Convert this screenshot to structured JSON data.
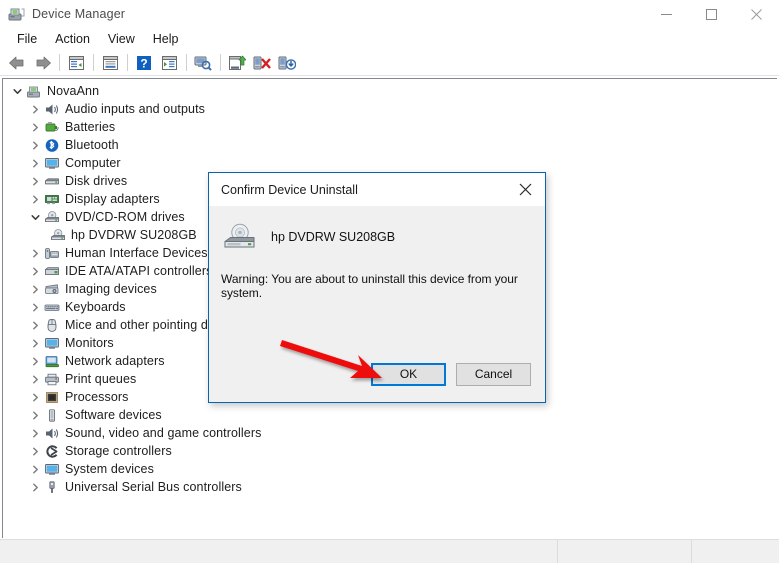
{
  "window": {
    "title": "Device Manager",
    "icon": "device-manager-icon",
    "controls": {
      "minimize": "Minimize",
      "maximize": "Maximize",
      "close": "Close"
    }
  },
  "menubar": {
    "items": [
      {
        "label": "File"
      },
      {
        "label": "Action"
      },
      {
        "label": "View"
      },
      {
        "label": "Help"
      }
    ]
  },
  "toolbar": {
    "buttons": [
      {
        "name": "back-icon",
        "tooltip": "Back"
      },
      {
        "name": "forward-icon",
        "tooltip": "Forward"
      },
      {
        "name": "show-hide-console-tree-icon",
        "tooltip": "Show/Hide Console Tree"
      },
      {
        "name": "properties-icon",
        "tooltip": "Properties"
      },
      {
        "name": "help-icon",
        "tooltip": "Help"
      },
      {
        "name": "show-hide-action-pane-icon",
        "tooltip": "Show/Hide Action Pane"
      },
      {
        "name": "scan-for-hardware-changes-icon",
        "tooltip": "Scan for hardware changes"
      },
      {
        "name": "update-driver-icon",
        "tooltip": "Update driver"
      },
      {
        "name": "uninstall-device-icon",
        "tooltip": "Uninstall device"
      },
      {
        "name": "disable-device-icon",
        "tooltip": "Disable device"
      }
    ]
  },
  "tree": {
    "nodes": [
      {
        "label": "NovaAnn",
        "level": 0,
        "twisty": "expanded",
        "icon": "computer-icon"
      },
      {
        "label": "Audio inputs and outputs",
        "level": 1,
        "twisty": "collapsed",
        "icon": "speaker-icon"
      },
      {
        "label": "Batteries",
        "level": 1,
        "twisty": "collapsed",
        "icon": "battery-icon"
      },
      {
        "label": "Bluetooth",
        "level": 1,
        "twisty": "collapsed",
        "icon": "bluetooth-icon"
      },
      {
        "label": "Computer",
        "level": 1,
        "twisty": "collapsed",
        "icon": "monitor-icon"
      },
      {
        "label": "Disk drives",
        "level": 1,
        "twisty": "collapsed",
        "icon": "disk-drive-icon"
      },
      {
        "label": "Display adapters",
        "level": 1,
        "twisty": "collapsed",
        "icon": "display-adapter-icon"
      },
      {
        "label": "DVD/CD-ROM drives",
        "level": 1,
        "twisty": "expanded",
        "icon": "dvd-drive-icon"
      },
      {
        "label": "hp DVDRW  SU208GB",
        "level": 2,
        "twisty": "none",
        "icon": "dvd-drive-icon"
      },
      {
        "label": "Human Interface Devices",
        "level": 1,
        "twisty": "collapsed",
        "icon": "hid-icon"
      },
      {
        "label": "IDE ATA/ATAPI controllers",
        "level": 1,
        "twisty": "collapsed",
        "icon": "ide-controller-icon"
      },
      {
        "label": "Imaging devices",
        "level": 1,
        "twisty": "collapsed",
        "icon": "imaging-device-icon"
      },
      {
        "label": "Keyboards",
        "level": 1,
        "twisty": "collapsed",
        "icon": "keyboard-icon"
      },
      {
        "label": "Mice and other pointing de",
        "level": 1,
        "twisty": "collapsed",
        "icon": "mouse-icon"
      },
      {
        "label": "Monitors",
        "level": 1,
        "twisty": "collapsed",
        "icon": "monitor-icon"
      },
      {
        "label": "Network adapters",
        "level": 1,
        "twisty": "collapsed",
        "icon": "network-adapter-icon"
      },
      {
        "label": "Print queues",
        "level": 1,
        "twisty": "collapsed",
        "icon": "printer-icon"
      },
      {
        "label": "Processors",
        "level": 1,
        "twisty": "collapsed",
        "icon": "processor-icon"
      },
      {
        "label": "Software devices",
        "level": 1,
        "twisty": "collapsed",
        "icon": "software-device-icon"
      },
      {
        "label": "Sound, video and game controllers",
        "level": 1,
        "twisty": "collapsed",
        "icon": "speaker-icon"
      },
      {
        "label": "Storage controllers",
        "level": 1,
        "twisty": "collapsed",
        "icon": "storage-controller-icon"
      },
      {
        "label": "System devices",
        "level": 1,
        "twisty": "collapsed",
        "icon": "monitor-icon"
      },
      {
        "label": "Universal Serial Bus controllers",
        "level": 1,
        "twisty": "collapsed",
        "icon": "usb-icon"
      }
    ]
  },
  "dialog": {
    "title": "Confirm Device Uninstall",
    "close_label": "Close",
    "device_name": "hp DVDRW  SU208GB",
    "device_icon": "dvd-drive-icon",
    "warning": "Warning: You are about to uninstall this device from your system.",
    "ok_label": "OK",
    "cancel_label": "Cancel"
  },
  "annotation": {
    "arrow": "red-arrow-pointing-to-ok",
    "color": "#ee1111"
  },
  "statusbar": {
    "segments": [
      "",
      "",
      ""
    ]
  },
  "colors": {
    "accent_blue": "#0078d7",
    "dialog_border": "#0a64ad",
    "arrow_red": "#ee1111",
    "window_bg": "#ffffff",
    "dialog_bg": "#f0f0f0",
    "status_bg": "#f0f0f0"
  }
}
